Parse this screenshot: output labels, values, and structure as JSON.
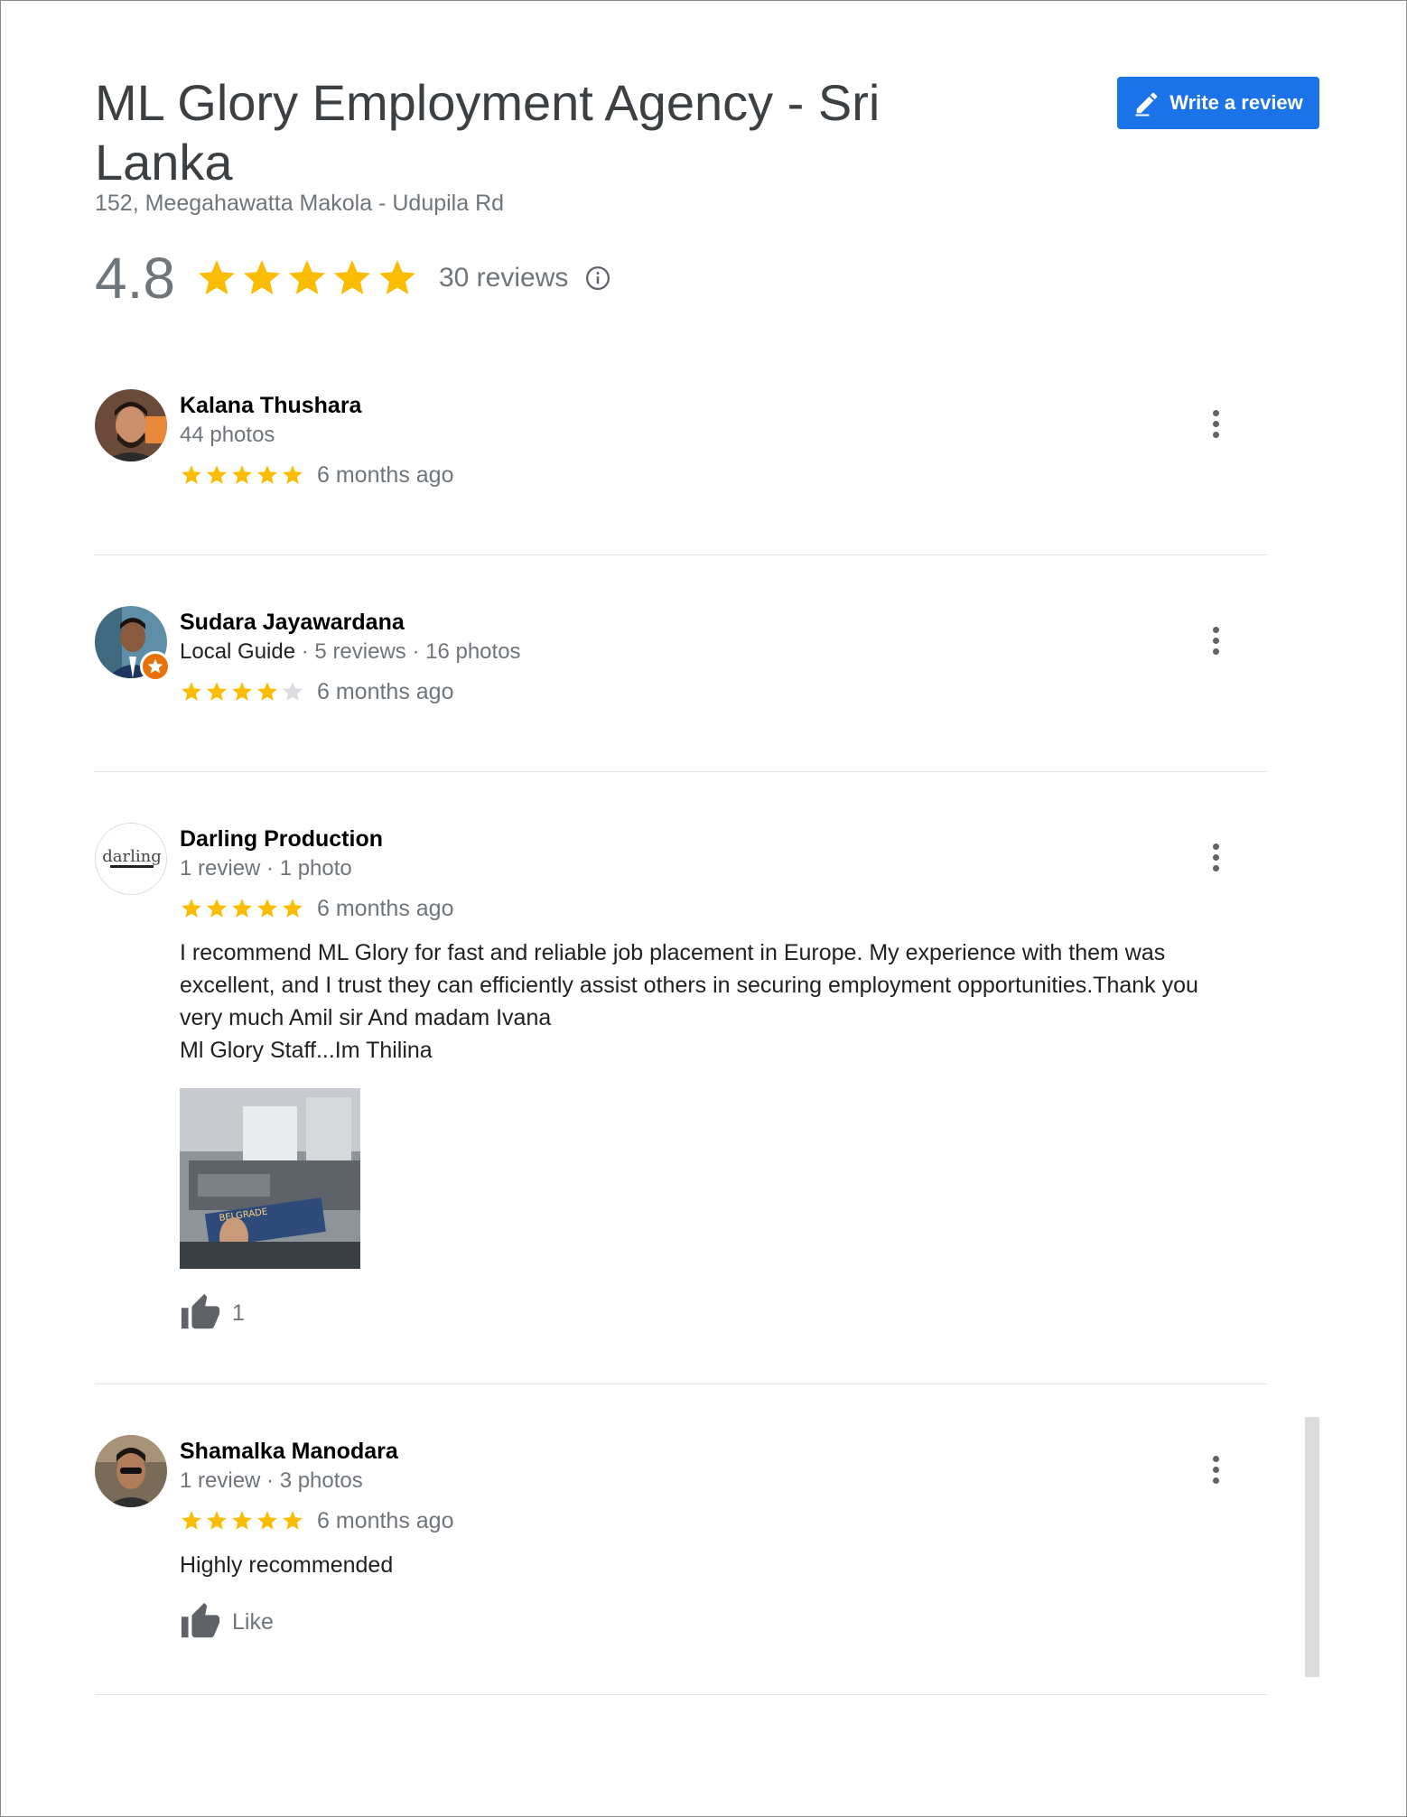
{
  "header": {
    "title": "ML Glory Employment Agency - Sri Lanka",
    "address": "152, Meegahawatta Makola - Udupila Rd",
    "write_review_label": "Write a review"
  },
  "summary": {
    "score": "4.8",
    "stars": 5,
    "reviews_count_label": "30 reviews",
    "star_color": "#fbbc04"
  },
  "reviews": [
    {
      "name": "Kalana Thushara",
      "meta": "44 photos",
      "rating": 5,
      "time": "6 months ago"
    },
    {
      "name": "Sudara Jayawardana",
      "meta_guide": "Local Guide",
      "meta": " · 5 reviews · 16 photos",
      "rating": 4,
      "time": "6 months ago"
    },
    {
      "name": "Darling Production",
      "meta": "1 review · 1 photo",
      "rating": 5,
      "time": "6 months ago",
      "text": "I recommend ML Glory for fast and reliable job placement in Europe. My experience with them was excellent, and I trust they can efficiently assist others in securing employment opportunities.Thank you very much Amil sir And madam Ivana",
      "text_line2": "Ml Glory Staff...Im Thilina",
      "avatar_text": "darling",
      "photo_text": "BELGRADE",
      "likes": "1"
    },
    {
      "name": "Shamalka Manodara",
      "meta": "1 review · 3 photos",
      "rating": 5,
      "time": "6 months ago",
      "text": "Highly recommended",
      "like_label": "Like"
    }
  ],
  "colors": {
    "accent": "#1a73e8",
    "star_filled": "#fbbc04",
    "star_empty": "#dadce0",
    "muted_text": "#70757a",
    "local_guide_badge": "#e8710a"
  },
  "icons": {
    "write": "pencil-icon",
    "info": "info-icon",
    "more": "more-vert-icon",
    "like": "thumb-up-icon"
  }
}
